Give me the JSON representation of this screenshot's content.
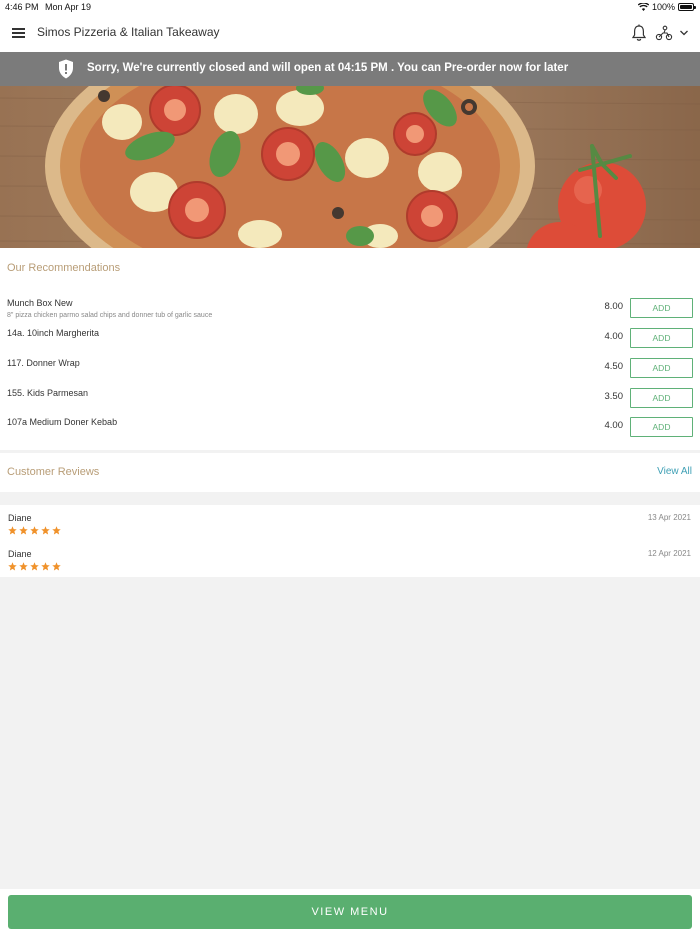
{
  "status_bar": {
    "time": "4:46 PM",
    "date": "Mon Apr 19",
    "battery": "100%"
  },
  "header": {
    "title": "Simos Pizzeria & Italian Takeaway"
  },
  "banner": {
    "message": "Sorry, We're currently closed and will open at 04:15 PM . You can Pre-order now for later"
  },
  "recommendations": {
    "title": "Our Recommendations",
    "add_label": "ADD",
    "items": [
      {
        "name": "Munch Box New",
        "description": "8\" pizza chicken parmo salad chips and donner tub of garlic sauce",
        "price": "8.00"
      },
      {
        "name": "14a. 10inch Margherita",
        "description": "",
        "price": "4.00"
      },
      {
        "name": "117. Donner Wrap",
        "description": "",
        "price": "4.50"
      },
      {
        "name": "155. Kids Parmesan",
        "description": "",
        "price": "3.50"
      },
      {
        "name": "107a Medium Doner Kebab",
        "description": "",
        "price": "4.00"
      }
    ]
  },
  "reviews": {
    "title": "Customer Reviews",
    "view_all": "View All",
    "items": [
      {
        "name": "Diane",
        "date": "13 Apr 2021",
        "rating": 5
      },
      {
        "name": "Diane",
        "date": "12 Apr 2021",
        "rating": 5
      }
    ]
  },
  "footer": {
    "button": "VIEW MENU"
  },
  "colors": {
    "accent_green": "#5aaf70",
    "section_title": "#b89d77",
    "link_blue": "#3fa0b5",
    "star": "#f0922b",
    "banner": "#7b7b7b"
  }
}
